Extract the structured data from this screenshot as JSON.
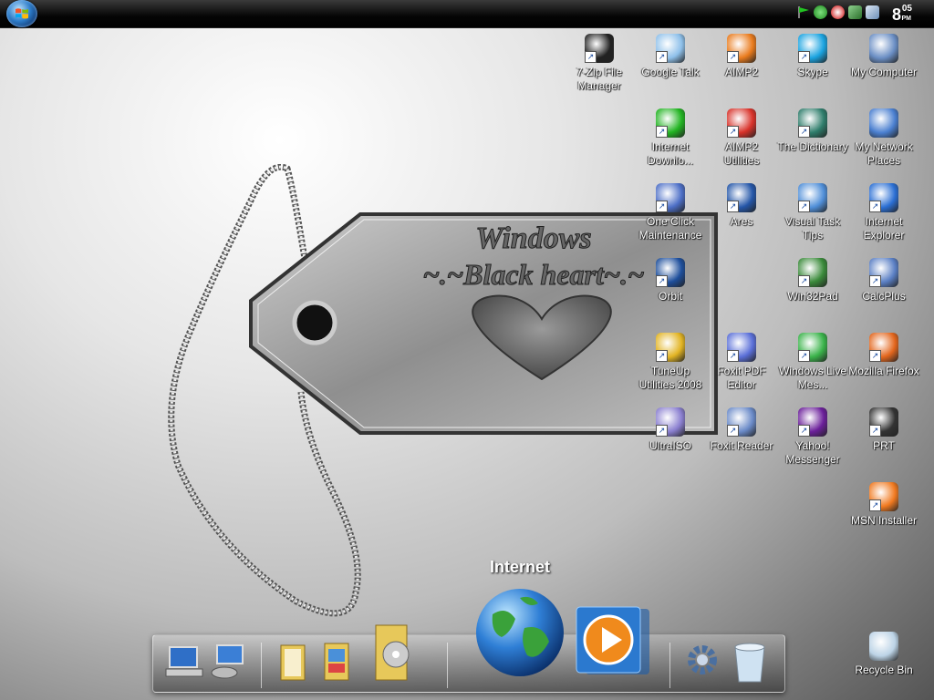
{
  "taskbar": {
    "clock_hour": "8",
    "clock_minutes": "05",
    "clock_ampm": "PM"
  },
  "tag": {
    "line1": "Windows",
    "line2": "~.~Black heart~.~"
  },
  "icons": [
    {
      "label": "7-Zip File Manager",
      "icon": "7zip-icon"
    },
    {
      "label": "Google Talk",
      "icon": "google-talk-icon"
    },
    {
      "label": "AIMP2",
      "icon": "aimp2-icon"
    },
    {
      "label": "Skype",
      "icon": "skype-icon"
    },
    {
      "label": "My Computer",
      "icon": "my-computer-icon"
    },
    {
      "label": "Internet Downlo...",
      "icon": "internet-download-manager-icon"
    },
    {
      "label": "AIMP2 Utilities",
      "icon": "aimp2-utilities-icon"
    },
    {
      "label": "The Dictionary",
      "icon": "dictionary-icon"
    },
    {
      "label": "My Network Places",
      "icon": "network-places-icon"
    },
    {
      "label": "One Click Maintenance",
      "icon": "one-click-maintenance-icon"
    },
    {
      "label": "Ares",
      "icon": "ares-icon"
    },
    {
      "label": "Visual Task Tips",
      "icon": "visual-task-tips-icon"
    },
    {
      "label": "Internet Explorer",
      "icon": "internet-explorer-icon"
    },
    {
      "label": "Orbit",
      "icon": "orbit-icon"
    },
    {
      "label": "Win32Pad",
      "icon": "win32pad-icon"
    },
    {
      "label": "CalcPlus",
      "icon": "calcplus-icon"
    },
    {
      "label": "TuneUp Utilities 2008",
      "icon": "tuneup-icon"
    },
    {
      "label": "Foxit PDF Editor",
      "icon": "foxit-pdf-editor-icon"
    },
    {
      "label": "Windows Live Mes...",
      "icon": "windows-live-messenger-icon"
    },
    {
      "label": "Mozilla Firefox",
      "icon": "firefox-icon"
    },
    {
      "label": "UltraISO",
      "icon": "ultraiso-icon"
    },
    {
      "label": "Foxit Reader",
      "icon": "foxit-reader-icon"
    },
    {
      "label": "Yahoo! Messenger",
      "icon": "yahoo-messenger-icon"
    },
    {
      "label": "PRT",
      "icon": "prt-icon"
    },
    {
      "label": "MSN Installer",
      "icon": "msn-installer-icon"
    },
    {
      "label": "Recycle Bin",
      "icon": "recycle-bin-icon"
    }
  ],
  "dock": {
    "hover_label": "Internet"
  }
}
